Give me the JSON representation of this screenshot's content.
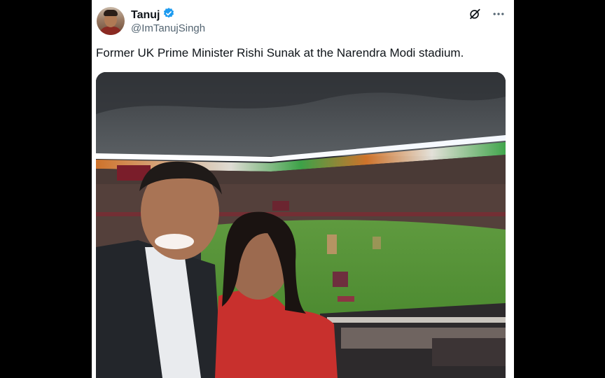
{
  "author": {
    "display_name": "Tanuj",
    "handle": "@ImTanujSingh",
    "verified": true,
    "avatar_icon": "profile-photo"
  },
  "tweet": {
    "text": "Former UK Prime Minister Rishi Sunak at the Narendra Modi stadium."
  },
  "media": {
    "icon": "stadium-photo"
  },
  "actions": {
    "grok_icon": "grok-icon",
    "more_icon": "more-icon"
  },
  "colors": {
    "verified": "#1d9bf0",
    "text": "#0f1419",
    "secondary": "#536471"
  }
}
